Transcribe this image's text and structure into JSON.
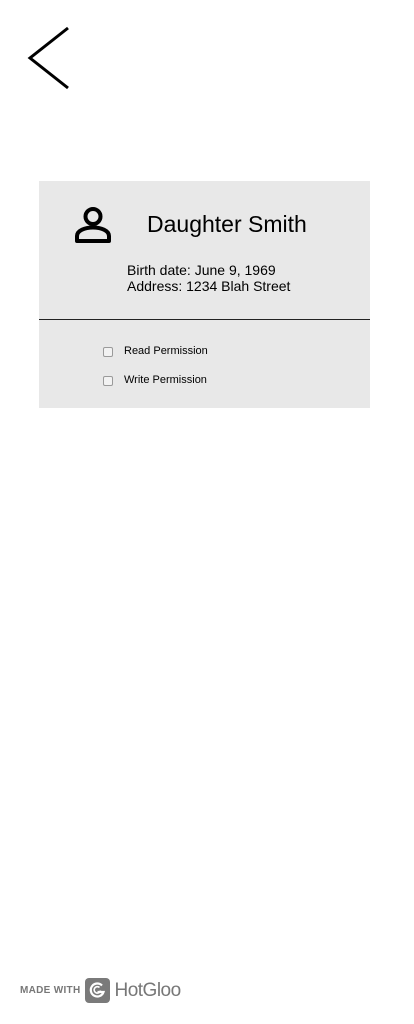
{
  "header": {
    "back_icon": "chevron-left-icon"
  },
  "profile": {
    "avatar_icon": "person-icon",
    "name": "Daughter Smith",
    "birth_date": "Birth date: June 9, 1969",
    "address": "Address: 1234 Blah Street"
  },
  "permissions": {
    "read": {
      "label": "Read Permission",
      "checked": false
    },
    "write": {
      "label": "Write Permission",
      "checked": false
    }
  },
  "footer": {
    "made_with": "MADE WITH",
    "brand": "HotGloo"
  },
  "colors": {
    "card_background": "#e8e8e8",
    "divider": "#222222",
    "brand_gray": "#777777"
  }
}
